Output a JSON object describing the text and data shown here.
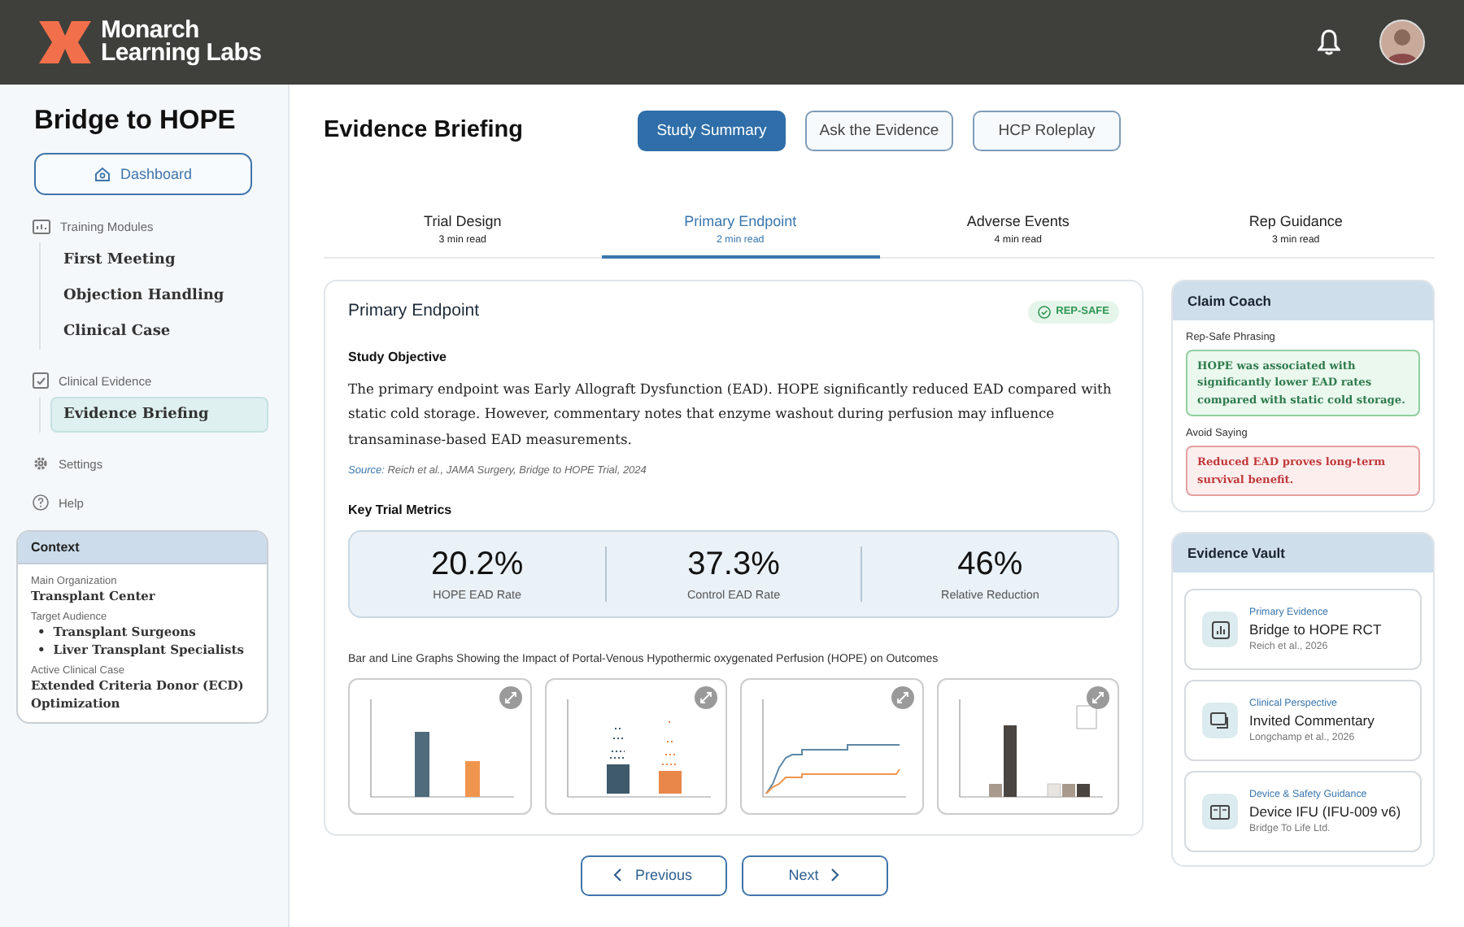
{
  "header": {
    "brand_line_1": "Monarch",
    "brand_line_2": "Learning Labs"
  },
  "sidebar": {
    "title": "Bridge to HOPE",
    "dashboard": "Dashboard",
    "nav": [
      {
        "label": "Training Modules",
        "children": [
          {
            "label": "First Meeting",
            "selected": false
          },
          {
            "label": "Objection Handling",
            "selected": false
          },
          {
            "label": "Clinical Case",
            "selected": false
          }
        ]
      },
      {
        "label": "Clinical Evidence",
        "children": [
          {
            "label": "Evidence Briefing",
            "selected": true
          }
        ]
      },
      {
        "label": "Settings"
      },
      {
        "label": "Help"
      }
    ],
    "context": {
      "title": "Context",
      "fields": [
        {
          "kind": "text",
          "label": "Main Organization",
          "values": [
            "Transplant Center"
          ]
        },
        {
          "kind": "list",
          "label": "Target Audience",
          "marker": "•",
          "values": [
            "Transplant Surgeons",
            "Liver Transplant Specialists"
          ]
        },
        {
          "kind": "text",
          "label": "Active Clinical Case",
          "values": [
            "Extended Criteria Donor (ECD) Optimization"
          ]
        }
      ]
    }
  },
  "main": {
    "title": "Evidence Briefing",
    "modes": [
      {
        "label": "Study Summary",
        "selected": true
      },
      {
        "label": "Ask the Evidence",
        "selected": false
      },
      {
        "label": "HCP Roleplay",
        "selected": false
      }
    ],
    "tabs": [
      {
        "label": "Trial Design",
        "meta": "3 min read",
        "selected": false
      },
      {
        "label": "Primary Endpoint",
        "meta": "2 min read",
        "selected": true
      },
      {
        "label": "Adverse Events",
        "meta": "4 min read",
        "selected": false
      },
      {
        "label": "Rep Guidance",
        "meta": "3 min read",
        "selected": false
      }
    ],
    "card": {
      "title": "Primary Endpoint",
      "badge": "REP-SAFE",
      "objective_heading": "Study Objective",
      "objective_text": "The primary endpoint was Early Allograft Dysfunction (EAD). HOPE significantly reduced EAD compared with static cold storage. However, commentary notes that enzyme washout during perfusion may influence transaminase-based EAD measurements.",
      "source_label": "Source:",
      "source_text": "Reich et al., JAMA Surgery, Bridge to HOPE Trial, 2024",
      "metrics_heading": "Key Trial Metrics",
      "metrics": [
        {
          "value": "20.2%",
          "label": "HOPE EAD Rate"
        },
        {
          "value": "37.3%",
          "label": "Control EAD Rate"
        },
        {
          "value": "46%",
          "label": "Relative Reduction"
        }
      ],
      "figures_caption": "Bar and Line Graphs Showing the Impact of Portal-Venous Hypothermic oxygenated Perfusion (HOPE) on Outcomes",
      "figures": [
        {
          "kind": "bar"
        },
        {
          "kind": "dot"
        },
        {
          "kind": "line"
        },
        {
          "kind": "grouped"
        }
      ]
    },
    "pager": {
      "previous": "Previous",
      "next": "Next"
    }
  },
  "claim_coach": {
    "title": "Claim Coach",
    "safe_label": "Rep-Safe Phrasing",
    "safe_text": "HOPE was associated with significantly lower EAD rates compared with static cold storage.",
    "avoid_label": "Avoid Saying",
    "avoid_text": "Reduced EAD proves long-term survival benefit."
  },
  "evidence_vault": {
    "title": "Evidence Vault",
    "items": [
      {
        "kind": "chart",
        "category": "Primary Evidence",
        "title": "Bridge to HOPE RCT",
        "author": "Reich et al., 2026"
      },
      {
        "kind": "comment",
        "category": "Clinical Perspective",
        "title": "Invited Commentary",
        "author": "Longchamp et al., 2026"
      },
      {
        "kind": "device",
        "category": "Device & Safety Guidance",
        "title": "Device IFU (IFU-009 v6)",
        "author": "Bridge To Life Ltd."
      }
    ]
  }
}
